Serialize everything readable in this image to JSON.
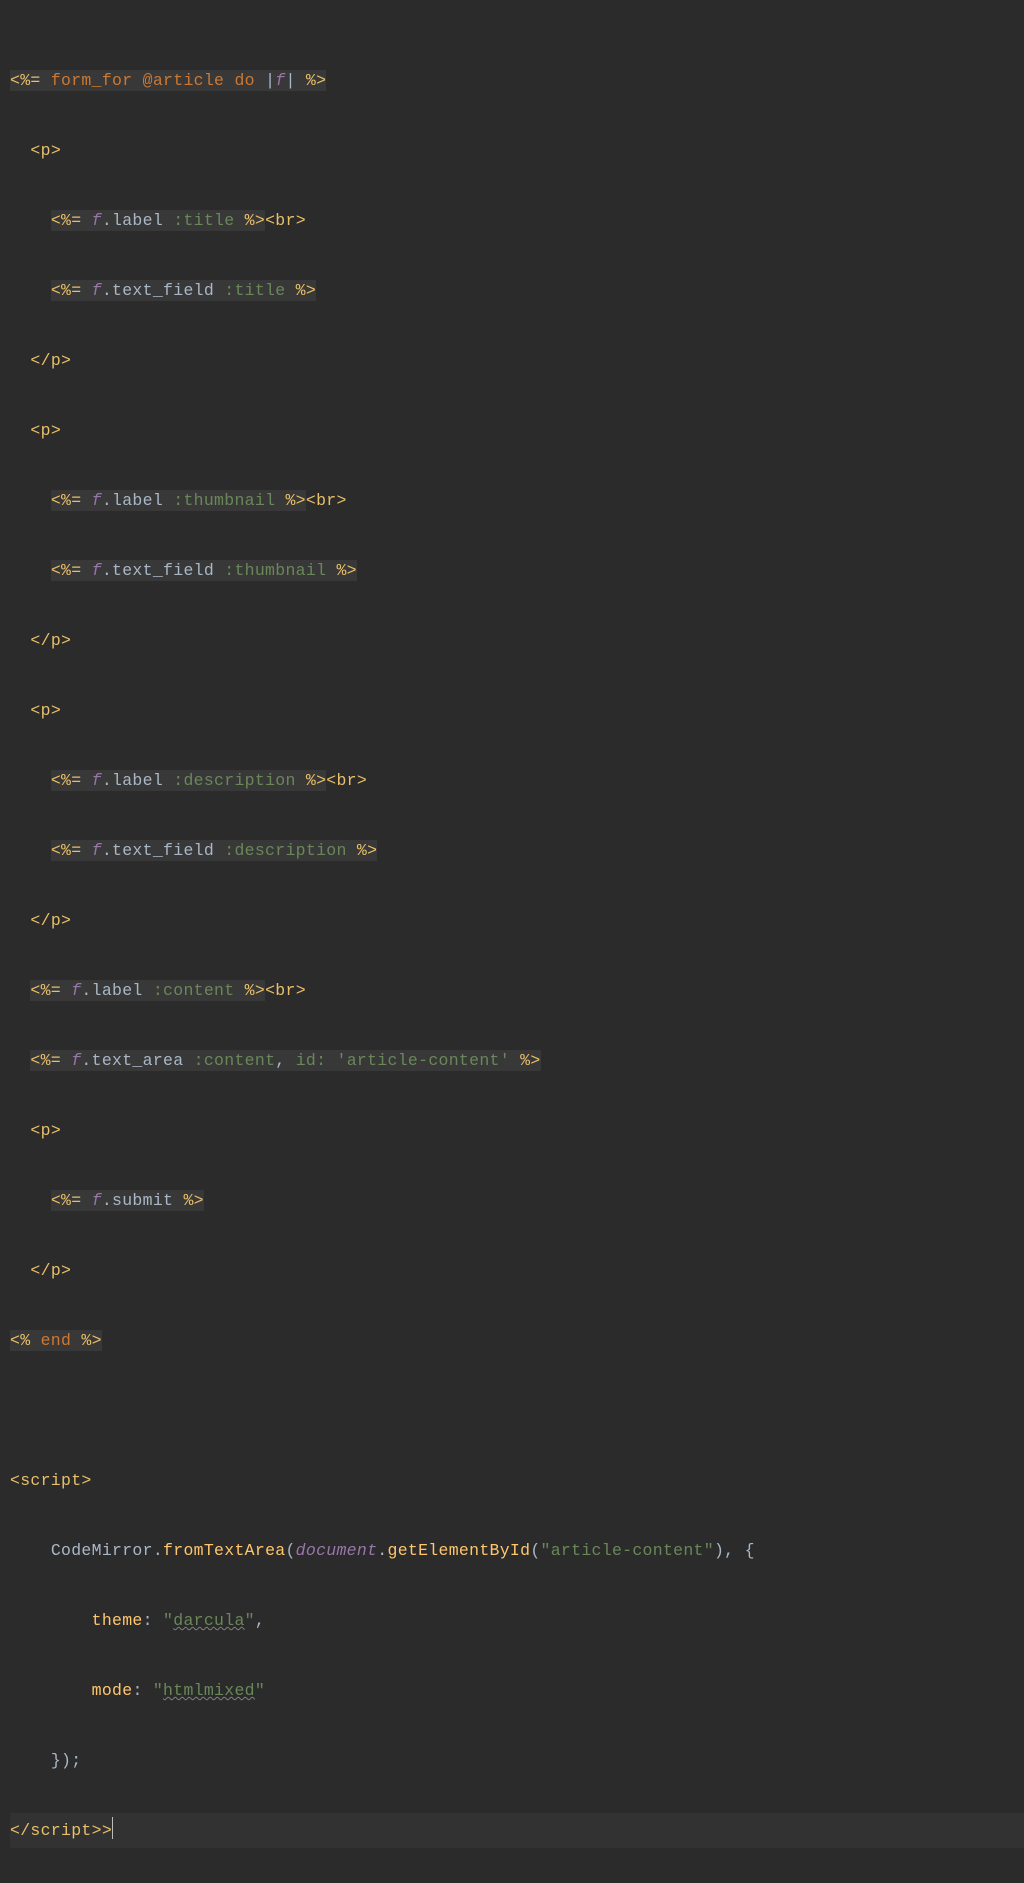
{
  "code": {
    "l1": {
      "open": "<%= ",
      "fn": "form_for ",
      "at": "@article",
      "do": " do ",
      "pipe1": "|",
      "f": "f",
      "pipe2": "|",
      "close": " %>"
    },
    "l2": {
      "open": "<",
      "tag": "p",
      "close": ">"
    },
    "l3": {
      "open": "<%= ",
      "f": "f",
      "dot": ".",
      "m": "label ",
      "sym": ":title",
      "close": " %>",
      "br_open": "<",
      "br": "br",
      "br_close": ">"
    },
    "l4": {
      "open": "<%= ",
      "f": "f",
      "dot": ".",
      "m": "text_field ",
      "sym": ":title",
      "close": " %>"
    },
    "l5": {
      "open": "</",
      "tag": "p",
      "close": ">"
    },
    "l6": {
      "open": "<",
      "tag": "p",
      "close": ">"
    },
    "l7": {
      "open": "<%= ",
      "f": "f",
      "dot": ".",
      "m": "label ",
      "sym": ":thumbnail",
      "close": " %>",
      "br_open": "<",
      "br": "br",
      "br_close": ">"
    },
    "l8": {
      "open": "<%= ",
      "f": "f",
      "dot": ".",
      "m": "text_field ",
      "sym": ":thumbnail",
      "close": " %>"
    },
    "l9": {
      "open": "</",
      "tag": "p",
      "close": ">"
    },
    "l10": {
      "open": "<",
      "tag": "p",
      "close": ">"
    },
    "l11": {
      "open": "<%= ",
      "f": "f",
      "dot": ".",
      "m": "label ",
      "sym": ":description",
      "close": " %>",
      "br_open": "<",
      "br": "br",
      "br_close": ">"
    },
    "l12": {
      "open": "<%= ",
      "f": "f",
      "dot": ".",
      "m": "text_field ",
      "sym": ":description",
      "close": " %>"
    },
    "l13": {
      "open": "</",
      "tag": "p",
      "close": ">"
    },
    "l14": {
      "open": "<%= ",
      "f": "f",
      "dot": ".",
      "m": "label ",
      "sym": ":content",
      "close": " %>",
      "br_open": "<",
      "br": "br",
      "br_close": ">"
    },
    "l15": {
      "open": "<%= ",
      "f": "f",
      "dot": ".",
      "m": "text_area ",
      "sym": ":content",
      "comma": ", ",
      "key": "id: ",
      "str": "'article-content'",
      "close": " %>"
    },
    "l16": {
      "open": "<",
      "tag": "p",
      "close": ">"
    },
    "l17": {
      "open": "<%= ",
      "f": "f",
      "dot": ".",
      "m": "submit",
      "close": " %>"
    },
    "l18": {
      "open": "</",
      "tag": "p",
      "close": ">"
    },
    "l19": {
      "open": "<% ",
      "end": "end",
      "close": " %>"
    },
    "l20": "",
    "l21": {
      "open": "<",
      "tag": "script",
      "close": ">"
    },
    "l22": {
      "cm": "CodeMirror",
      "dot": ".",
      "fn": "fromTextArea",
      "p1": "(",
      "doc": "document",
      "dot2": ".",
      "gid": "getElementById",
      "p2": "(",
      "str": "\"article-content\"",
      "p3": ")",
      "comma": ", ",
      "brace": "{"
    },
    "l23": {
      "key": "theme",
      "colon": ": ",
      "q": "\"",
      "val": "darcula",
      "q2": "\"",
      "comma": ","
    },
    "l24": {
      "key": "mode",
      "colon": ": ",
      "q": "\"",
      "val": "htmlmixed",
      "q2": "\""
    },
    "l25": {
      "close": "});"
    },
    "l26": {
      "open": "</",
      "tag": "script",
      "close": ">",
      "extra": ">"
    }
  }
}
